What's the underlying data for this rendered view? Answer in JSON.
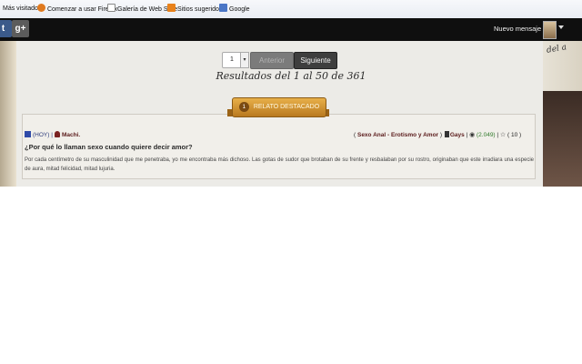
{
  "browser": {
    "bookmarks": [
      {
        "label": "Más visitados",
        "icon": "none"
      },
      {
        "label": "Comenzar a usar Firefox",
        "icon": "firefox-icon"
      },
      {
        "label": "Galería de Web Slice",
        "icon": "page-icon"
      },
      {
        "label": "Sitios sugeridos",
        "icon": "bookmark-orange-icon"
      },
      {
        "label": "Google",
        "icon": "google-icon"
      }
    ]
  },
  "topbar": {
    "social": [
      {
        "glyph": "t",
        "icon": "twitter-icon"
      },
      {
        "glyph": "g+",
        "icon": "google-plus-icon"
      }
    ],
    "new_message": "Nuevo mensaje"
  },
  "pagination": {
    "page_value": "1",
    "prev_label": "Anterior",
    "next_label": "Siguiente",
    "results_text": "Resultados del 1 al 50 de 361"
  },
  "featured": {
    "badge_number": "1",
    "badge_label": "RELATO DESTACADO",
    "date": "(HOY)",
    "author": "Machi.",
    "categories": "Sexo Anal - Erotismo y Amor",
    "group": "Gays",
    "views": "(2.049)",
    "rating": "10",
    "title": "¿Por qué lo llaman sexo cuando quiere decir amor?",
    "excerpt": "Por cada centímetro de su masculinidad que me penetraba, yo me encontraba más dichoso. Las gotas de sudor que brotaban de su frente y resbalaban por su rostro, originaban que este irradiara una especie de aura, mitad felicidad, mitad lujuria."
  },
  "decor": {
    "right_handwriting": "del a"
  },
  "colors": {
    "topbar": "#0f0f0f",
    "ribbon": "#d39a34",
    "author": "#5a1a1a",
    "views_green": "#2f7a2a"
  }
}
